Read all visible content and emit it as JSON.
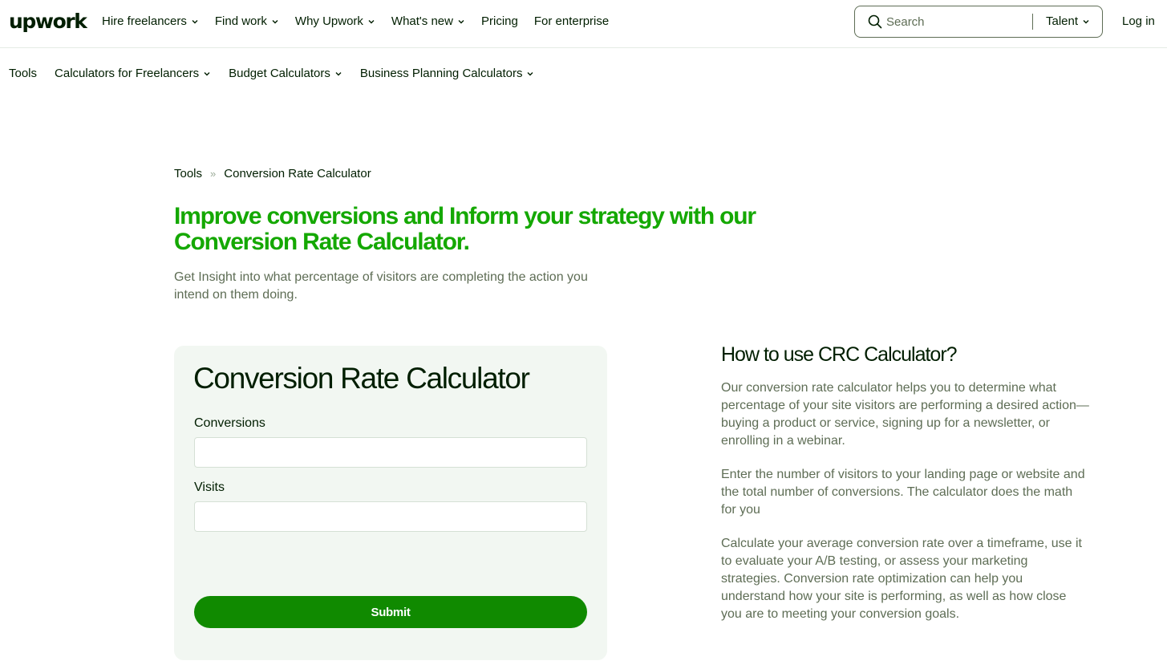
{
  "header": {
    "logo": "upwork",
    "nav": [
      {
        "label": "Hire freelancers",
        "dropdown": true
      },
      {
        "label": "Find work",
        "dropdown": true
      },
      {
        "label": "Why Upwork",
        "dropdown": true
      },
      {
        "label": "What's new",
        "dropdown": true
      },
      {
        "label": "Pricing",
        "dropdown": false
      },
      {
        "label": "For enterprise",
        "dropdown": false
      }
    ],
    "search": {
      "placeholder": "Search",
      "value": "",
      "scope": "Talent"
    },
    "login": "Log in"
  },
  "subnav": [
    {
      "label": "Tools",
      "dropdown": false
    },
    {
      "label": "Calculators for Freelancers",
      "dropdown": true
    },
    {
      "label": "Budget Calculators",
      "dropdown": true
    },
    {
      "label": "Business Planning Calculators",
      "dropdown": true
    }
  ],
  "breadcrumb": {
    "root": "Tools",
    "separator": "»",
    "current": "Conversion Rate Calculator"
  },
  "hero": {
    "title": "Improve conversions and Inform your strategy with our Conversion Rate Calculator.",
    "subtitle": "Get Insight into what percentage of visitors are completing the action you intend on them doing."
  },
  "calculator": {
    "title": "Conversion Rate Calculator",
    "conversions_label": "Conversions",
    "conversions_value": "",
    "visits_label": "Visits",
    "visits_value": "",
    "submit_label": "Submit"
  },
  "how_to": {
    "title": "How to use CRC Calculator?",
    "paragraphs": [
      "Our conversion rate calculator helps you to determine what percentage of your site visitors are performing a desired action—buying a product or service, signing up for a newsletter, or enrolling in a webinar.",
      "Enter the number of visitors to your landing page or website and the total number of conversions. The calculator does the math for you",
      "Calculate your average conversion rate over a timeframe, use it to evaluate your A/B testing, or assess your marketing strategies. Conversion rate optimization can help you understand how your site is performing, as well as how close you are to meeting your conversion goals."
    ]
  },
  "colors": {
    "brand_green": "#14a800",
    "button_green": "#108a00",
    "text_dark": "#001e00",
    "text_muted": "#5e6d55",
    "card_bg": "#f2f7f2"
  }
}
